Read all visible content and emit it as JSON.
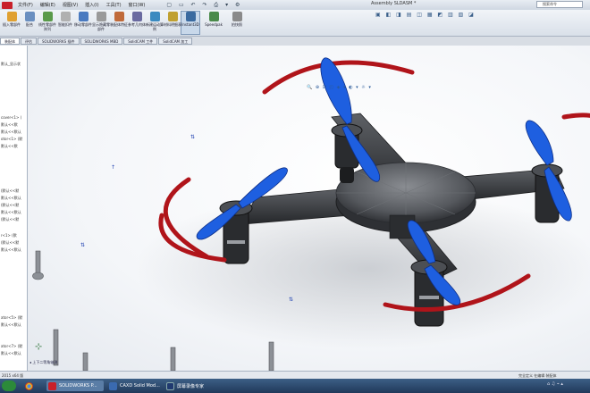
{
  "menu": {
    "items": [
      "文件(F)",
      "编辑(E)",
      "视图(V)",
      "插入(I)",
      "工具(T)",
      "窗口(W)"
    ],
    "title": "Assembly SLDASM *",
    "search_placeholder": "搜索命令"
  },
  "ribbon": {
    "buttons": [
      {
        "label": "插入零部件",
        "icon": "insert-component-icon",
        "color": "#e0a030"
      },
      {
        "label": "配合",
        "icon": "mate-icon",
        "color": "#6a8fc0"
      },
      {
        "label": "线性零部件阵列",
        "icon": "linear-pattern-icon",
        "color": "#5a9a4a"
      },
      {
        "label": "智能扣件",
        "icon": "smart-fasteners-icon",
        "color": "#b0b0b0"
      },
      {
        "label": "移动零部件",
        "icon": "move-component-icon",
        "color": "#4a7ac0"
      },
      {
        "label": "显示隐藏零部件",
        "icon": "show-hidden-icon",
        "color": "#9a9a9a"
      },
      {
        "label": "装配体特征",
        "icon": "assembly-features-icon",
        "color": "#c06a3a"
      },
      {
        "label": "参考几何体",
        "icon": "reference-geometry-icon",
        "color": "#6a6aa0"
      },
      {
        "label": "新建运动算例",
        "icon": "motion-study-icon",
        "color": "#3a8ac0"
      },
      {
        "label": "材料明细表",
        "icon": "bom-icon",
        "color": "#c0a030"
      },
      {
        "label": "爆炸视图",
        "icon": "exploded-view-icon",
        "color": "#a04a4a"
      },
      {
        "label": "爆炸直线草图",
        "icon": "explode-line-icon",
        "color": "#7a7a7a"
      },
      {
        "label": "Instant3D",
        "icon": "instant3d-icon",
        "color": "#3a6aa0"
      },
      {
        "label": "Speedpak",
        "icon": "speedpak-icon",
        "color": "#4a8a4a"
      },
      {
        "label": "拍快照",
        "icon": "snapshot-icon",
        "color": "#8a8a8a"
      }
    ]
  },
  "tabs": [
    "装配体",
    "评估",
    "SOLIDWORKS 插件",
    "SOLIDWORKS MBD",
    "SolidCAM 工件",
    "SolidCAM 加工"
  ],
  "tree": [
    "默认_显示状",
    "cover<1> (",
    "默认<<默",
    "默认<<默认",
    "otor<1> (默",
    "默认<<默",
    "(默认<<默",
    "默认<<默认",
    "(默认<<默",
    "默认<<默认",
    "(默认<<默",
    "r<1> (默",
    "(默认<<默",
    "默认<<默认",
    "ator<5> (默",
    "默认<<默认",
    "ator<7> (默",
    "默认<<默认"
  ],
  "view_tools": "🔍 ⊕ ⊡ ◰ ◈ ▾ ◐ ▾ ☼ ▾",
  "breadcrumb": "◂ 上下二等角轴测",
  "status": {
    "left": "2015 x64 版",
    "right": "完全定义  在编辑 装配体"
  },
  "taskbar": {
    "items": [
      {
        "label": "SOLIDWORKS P...",
        "icon": "solidworks-icon",
        "color": "#c8202a"
      },
      {
        "label": "CAXD Solid Mod...",
        "icon": "caxd-icon",
        "color": "#3a6ab0"
      },
      {
        "label": "屏幕录像专家",
        "icon": "screen-recorder-icon",
        "color": "#203a70"
      }
    ]
  },
  "colors": {
    "guard": "#b0141a",
    "propeller": "#1e5fe0",
    "frame": "#3a3c40"
  }
}
